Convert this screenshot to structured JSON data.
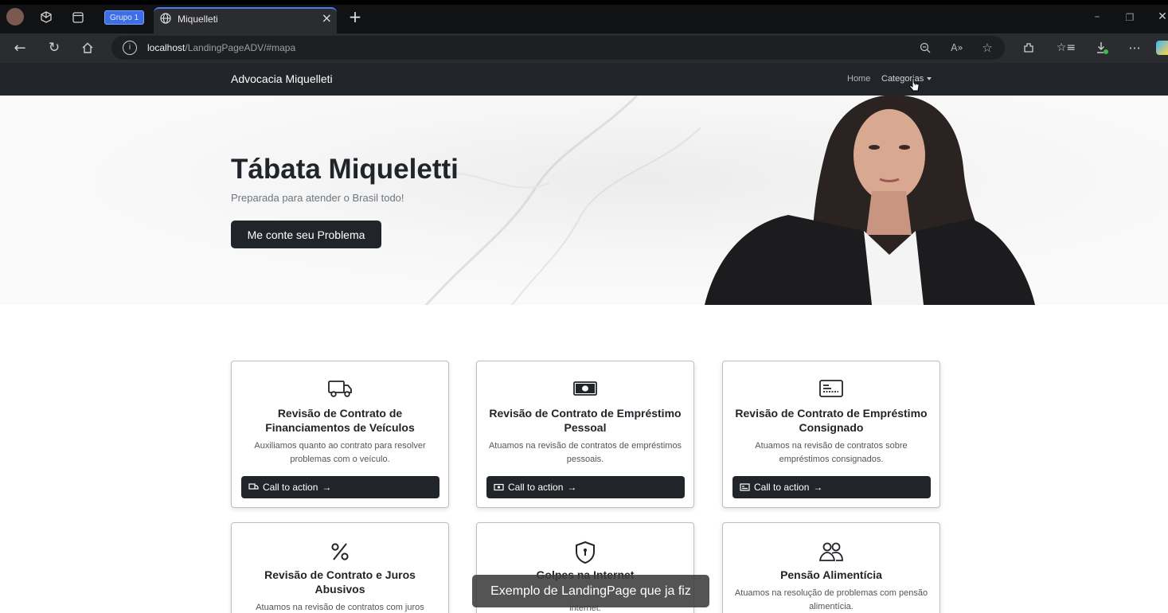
{
  "browser": {
    "group_label": "Grupo 1",
    "tab_title": "Miquelleti",
    "url_host": "localhost",
    "url_path": "/LandingPageADV/#mapa"
  },
  "site": {
    "brand": "Advocacia Miquelleti",
    "nav": {
      "home": "Home",
      "categories": "Categorias"
    }
  },
  "hero": {
    "title": "Tábata Miqueletti",
    "subtitle": "Preparada para atender o Brasil todo!",
    "button": "Me conte seu Problema"
  },
  "cards": [
    {
      "icon": "truck-icon",
      "title": "Revisão de Contrato de Financiamentos de Veículos",
      "text": "Auxiliamos quanto ao contrato para resolver problemas com o veículo.",
      "button": "Call to action"
    },
    {
      "icon": "cash-icon",
      "title": "Revisão de Contrato de Empréstimo Pessoal",
      "text": "Atuamos na revisão de contratos de empréstimos pessoais.",
      "button": "Call to action"
    },
    {
      "icon": "card-icon",
      "title": "Revisão de Contrato de Empréstimo Consignado",
      "text": "Atuamos na revisão de contratos sobre empréstimos consignados.",
      "button": "Call to action"
    },
    {
      "icon": "percent-icon",
      "title": "Revisão de Contrato e Juros Abusivos",
      "text": "Atuamos na revisão de contratos com juros",
      "button": ""
    },
    {
      "icon": "shield-icon",
      "title": "Golpes na Internet",
      "text": "internet.",
      "button": ""
    },
    {
      "icon": "people-icon",
      "title": "Pensão Alimentícia",
      "text": "Atuamos na resolução de problemas com pensão alimentícia.",
      "button": ""
    }
  ],
  "caption": "Exemplo de LandingPage que ja fiz"
}
